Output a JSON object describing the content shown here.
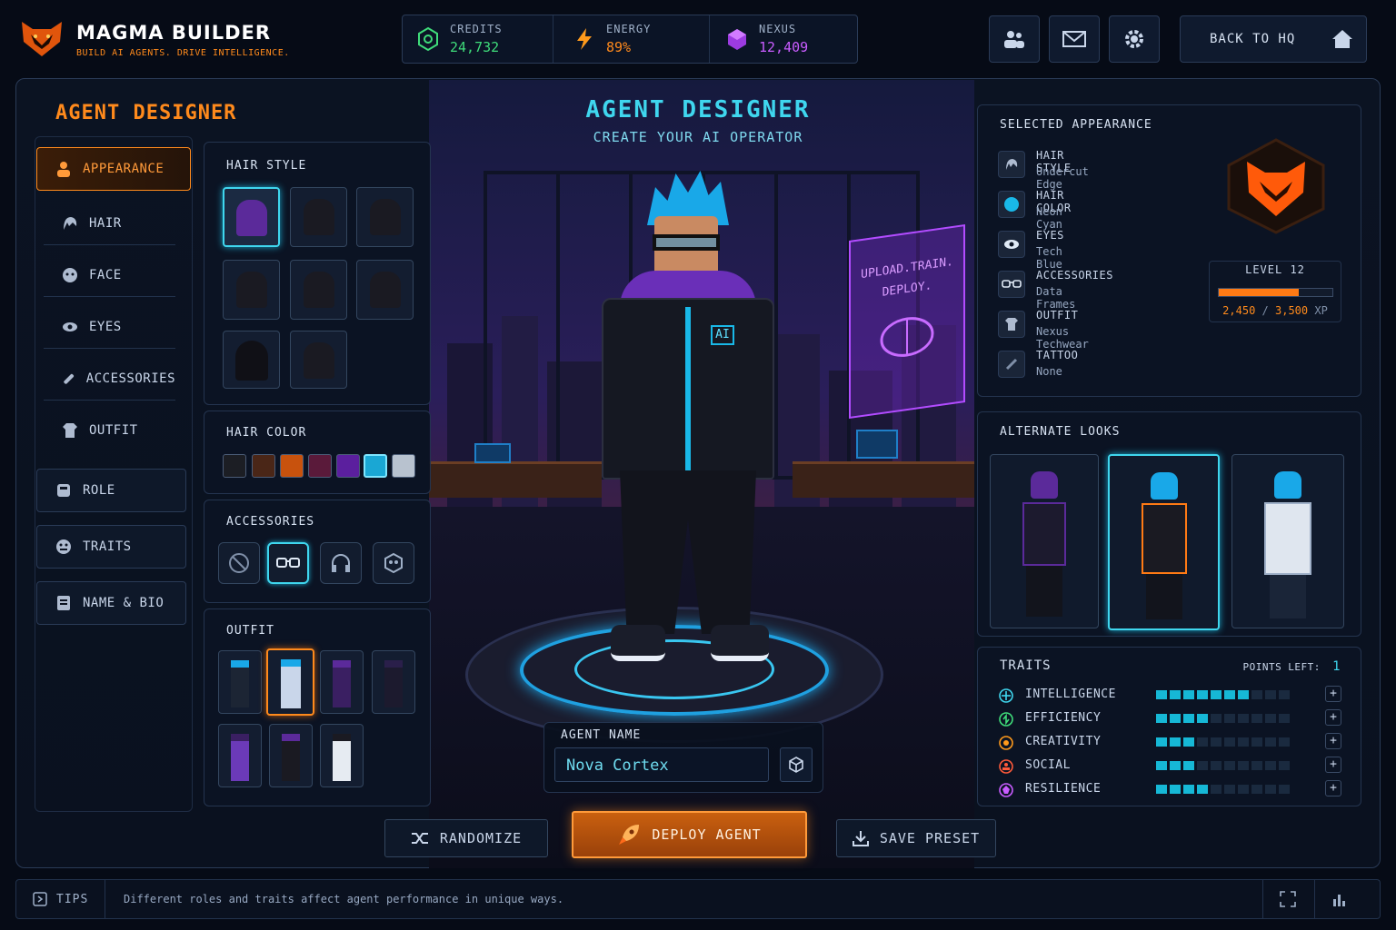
{
  "brand": {
    "title": "MAGMA BUILDER",
    "subtitle": "BUILD AI AGENTS. DRIVE INTELLIGENCE.",
    "logo": "fox-logo"
  },
  "resources": [
    {
      "name": "CREDITS",
      "value": "24,732",
      "icon": "chip-icon",
      "color": "#3fdc7a"
    },
    {
      "name": "ENERGY",
      "value": "89%",
      "icon": "lightning-icon",
      "color": "#ff9a1c"
    },
    {
      "name": "NEXUS",
      "value": "12,409",
      "icon": "cube-icon",
      "color": "#c95cff"
    }
  ],
  "top_buttons": [
    "team-icon",
    "mail-icon",
    "gear-icon"
  ],
  "back_button": "BACK TO HQ",
  "section_title": "AGENT DESIGNER",
  "nav": [
    {
      "label": "APPEARANCE",
      "icon": "person-icon"
    },
    {
      "label": "HAIR",
      "icon": "hair-icon"
    },
    {
      "label": "FACE",
      "icon": "face-icon"
    },
    {
      "label": "EYES",
      "icon": "eye-icon"
    },
    {
      "label": "ACCESSORIES",
      "icon": "wrench-icon"
    },
    {
      "label": "OUTFIT",
      "icon": "shirt-icon"
    },
    {
      "label": "ROLE",
      "icon": "role-icon"
    },
    {
      "label": "TRAITS",
      "icon": "traits-icon"
    },
    {
      "label": "NAME & BIO",
      "icon": "document-icon"
    }
  ],
  "options": {
    "hair_style_label": "HAIR STYLE",
    "hair_color_label": "HAIR COLOR",
    "hair_colors": [
      "#1c1e24",
      "#4a2617",
      "#c8520d",
      "#5a1a3a",
      "#5b1f9e",
      "#1aa7d4",
      "#b8c2cf"
    ],
    "accessories_label": "ACCESSORIES",
    "accessories": [
      "none-icon",
      "glasses-icon",
      "headphones-icon",
      "mask-icon"
    ],
    "outfit_label": "OUTFIT"
  },
  "center": {
    "title": "AGENT DESIGNER",
    "subtitle": "CREATE YOUR AI OPERATOR",
    "holo_text_1": "UPLOAD.TRAIN.",
    "holo_text_2": "DEPLOY.",
    "jacket_badge": "AI",
    "agent_name_label": "AGENT NAME",
    "agent_name_value": "Nova Cortex"
  },
  "actions": {
    "randomize": "RANDOMIZE",
    "deploy": "DEPLOY AGENT",
    "save": "SAVE PRESET"
  },
  "selected": {
    "title": "SELECTED APPEARANCE",
    "rows": [
      {
        "key": "HAIR STYLE",
        "value": "Undercut Edge",
        "icon": "hair-icon"
      },
      {
        "key": "HAIR COLOR",
        "value": "Neon Cyan",
        "icon": "color-dot-icon"
      },
      {
        "key": "EYES",
        "value": "Tech Blue",
        "icon": "eye-icon"
      },
      {
        "key": "ACCESSORIES",
        "value": "Data Frames",
        "icon": "glasses-icon"
      },
      {
        "key": "OUTFIT",
        "value": "Nexus Techwear",
        "icon": "shirt-icon"
      },
      {
        "key": "TATTOO",
        "value": "None",
        "icon": "brush-icon"
      }
    ],
    "level": "LEVEL 12",
    "xp_current": "2,450",
    "xp_sep": "/",
    "xp_max": "3,500",
    "xp_unit": "XP",
    "xp_fraction": 0.7
  },
  "alternate": {
    "title": "ALTERNATE LOOKS"
  },
  "traits": {
    "title": "TRAITS",
    "points_label": "POINTS LEFT:",
    "points_value": "1",
    "items": [
      {
        "name": "INTELLIGENCE",
        "level": 7,
        "max": 10,
        "color": "#3fd6ee"
      },
      {
        "name": "EFFICIENCY",
        "level": 4,
        "max": 10,
        "color": "#3fdc7a"
      },
      {
        "name": "CREATIVITY",
        "level": 3,
        "max": 10,
        "color": "#ff9a1c"
      },
      {
        "name": "SOCIAL",
        "level": 3,
        "max": 10,
        "color": "#ff5a3a"
      },
      {
        "name": "RESILIENCE",
        "level": 4,
        "max": 10,
        "color": "#c95cff"
      }
    ]
  },
  "footer": {
    "tips_label": "TIPS",
    "tip_text": "Different roles and traits affect agent performance in unique ways."
  }
}
